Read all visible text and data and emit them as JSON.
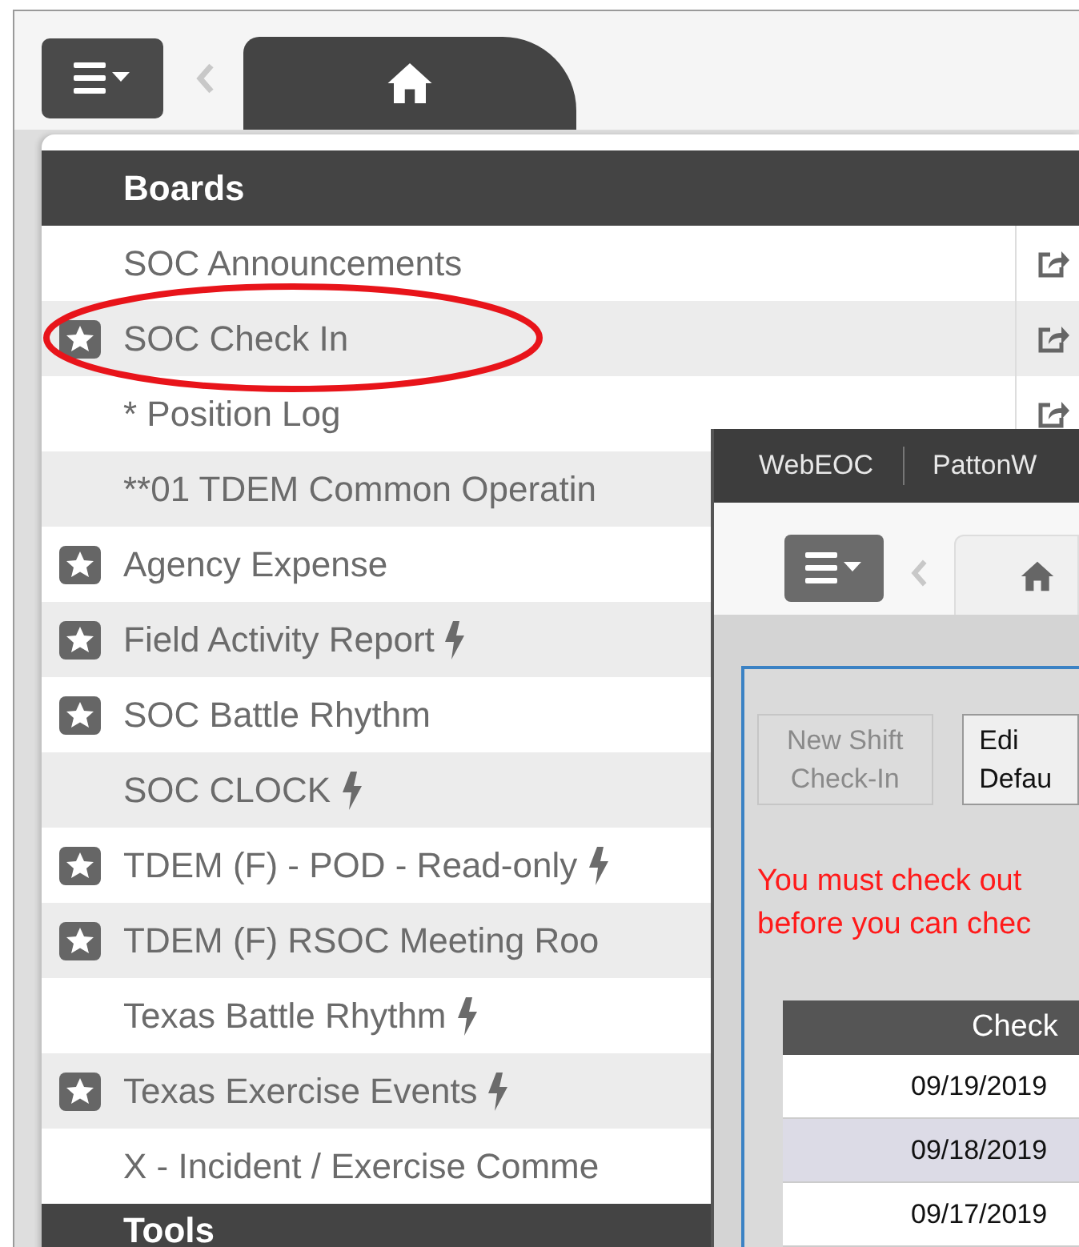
{
  "menu": {
    "header": "Boards",
    "items": [
      {
        "label": "SOC Announcements",
        "starred": false,
        "bolt": false,
        "share": true
      },
      {
        "label": "SOC Check In",
        "starred": true,
        "bolt": false,
        "share": true
      },
      {
        "label": "* Position Log",
        "starred": false,
        "bolt": false,
        "share": true
      },
      {
        "label": "**01 TDEM Common Operatin",
        "starred": false,
        "bolt": false
      },
      {
        "label": "Agency Expense",
        "starred": true,
        "bolt": false
      },
      {
        "label": "Field Activity Report",
        "starred": true,
        "bolt": true
      },
      {
        "label": "SOC Battle Rhythm",
        "starred": true,
        "bolt": false
      },
      {
        "label": "SOC CLOCK",
        "starred": false,
        "bolt": true
      },
      {
        "label": "TDEM (F) - POD - Read-only",
        "starred": true,
        "bolt": true
      },
      {
        "label": "TDEM (F) RSOC Meeting Roo",
        "starred": true,
        "bolt": false
      },
      {
        "label": "Texas Battle Rhythm",
        "starred": false,
        "bolt": true
      },
      {
        "label": "Texas Exercise Events",
        "starred": true,
        "bolt": true
      },
      {
        "label": "X - Incident / Exercise Comme",
        "starred": false,
        "bolt": false
      }
    ],
    "next_header": "Tools"
  },
  "popup": {
    "brand": "WebEOC",
    "user": "PattonW",
    "buttons": [
      {
        "lines": [
          "New Shift",
          "Check-In"
        ],
        "disabled": true
      },
      {
        "lines": [
          "Edi",
          "Defau"
        ],
        "disabled": false
      }
    ],
    "warning": [
      "You must check out",
      "before you can chec"
    ],
    "table": {
      "column": "Check",
      "rows": [
        "09/19/2019",
        "09/18/2019",
        "09/17/2019"
      ]
    }
  }
}
